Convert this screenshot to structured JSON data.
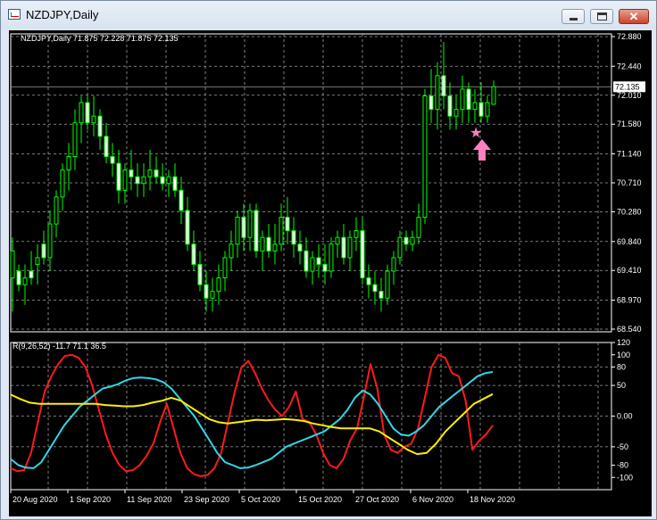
{
  "window": {
    "title": "NZDJPY,Daily",
    "minimize_glyph": "—",
    "maximize_glyph": "☐",
    "close_glyph": "✕"
  },
  "price_panel": {
    "info": "NZDJPY,Daily  71.875 72.228 71.875 72.135",
    "current_price": "72.135",
    "y_ticks": [
      "72.880",
      "72.440",
      "72.010",
      "71.580",
      "71.140",
      "70.710",
      "70.280",
      "69.840",
      "69.410",
      "68.970",
      "68.540"
    ],
    "candle_color": "#00ff00",
    "marker_star_color": "#ff80c0",
    "marker_arrow_color": "#ff80c0"
  },
  "indicator_panel": {
    "info": "R(9,26,52) -11.7 71.1 36.5",
    "y_ticks": [
      "120",
      "100",
      "80",
      "50",
      "0.00",
      "-50",
      "-80",
      "-100"
    ],
    "line_colors": {
      "red": "#ff1a1a",
      "cyan": "#33d6e6",
      "yellow": "#ffee00"
    }
  },
  "x_labels": [
    "20 Aug 2020",
    "1 Sep 2020",
    "11 Sep 2020",
    "23 Sep 2020",
    "5 Oct 2020",
    "15 Oct 2020",
    "27 Oct 2020",
    "6 Nov 2020",
    "18 Nov 2020"
  ],
  "chart_data": [
    {
      "type": "candlestick",
      "title": "NZDJPY,Daily",
      "ylim": [
        68.54,
        72.88
      ],
      "open": 71.875,
      "high": 72.228,
      "low": 71.875,
      "close": 72.135,
      "candles": [
        [
          69.3,
          69.9,
          68.8,
          69.7
        ],
        [
          69.4,
          69.5,
          69.1,
          69.2
        ],
        [
          69.2,
          69.5,
          68.9,
          69.3
        ],
        [
          69.4,
          69.7,
          69.2,
          69.3
        ],
        [
          69.5,
          69.8,
          69.2,
          69.6
        ],
        [
          69.8,
          70.0,
          69.5,
          69.6
        ],
        [
          69.6,
          70.3,
          69.4,
          70.1
        ],
        [
          70.1,
          70.6,
          69.9,
          70.5
        ],
        [
          70.5,
          71.0,
          70.3,
          70.9
        ],
        [
          70.9,
          71.3,
          70.6,
          71.1
        ],
        [
          71.1,
          71.8,
          70.9,
          71.6
        ],
        [
          71.6,
          72.0,
          71.3,
          71.9
        ],
        [
          71.9,
          72.0,
          71.5,
          71.6
        ],
        [
          71.6,
          72.0,
          71.4,
          71.7
        ],
        [
          71.7,
          71.8,
          71.2,
          71.4
        ],
        [
          71.4,
          71.6,
          71.0,
          71.1
        ],
        [
          71.1,
          71.3,
          70.8,
          71.0
        ],
        [
          71.0,
          71.2,
          70.4,
          70.6
        ],
        [
          70.6,
          71.0,
          70.4,
          70.9
        ],
        [
          70.9,
          71.2,
          70.6,
          70.8
        ],
        [
          70.8,
          71.0,
          70.5,
          70.7
        ],
        [
          70.7,
          71.0,
          70.5,
          70.8
        ],
        [
          70.8,
          71.2,
          70.6,
          70.9
        ],
        [
          70.9,
          71.1,
          70.7,
          70.8
        ],
        [
          70.8,
          71.0,
          70.6,
          70.7
        ],
        [
          70.7,
          70.9,
          70.5,
          70.8
        ],
        [
          70.8,
          71.0,
          70.5,
          70.6
        ],
        [
          70.6,
          70.8,
          70.1,
          70.3
        ],
        [
          70.3,
          70.5,
          69.7,
          69.8
        ],
        [
          69.8,
          70.0,
          69.4,
          69.5
        ],
        [
          69.5,
          69.7,
          69.1,
          69.2
        ],
        [
          69.2,
          69.4,
          68.8,
          69.0
        ],
        [
          69.0,
          69.3,
          68.8,
          69.1
        ],
        [
          69.1,
          69.5,
          68.9,
          69.3
        ],
        [
          69.3,
          69.7,
          69.1,
          69.6
        ],
        [
          69.6,
          70.0,
          69.4,
          69.8
        ],
        [
          69.8,
          70.3,
          69.6,
          70.2
        ],
        [
          70.2,
          70.4,
          69.7,
          69.9
        ],
        [
          69.9,
          70.4,
          69.7,
          70.3
        ],
        [
          70.3,
          70.4,
          69.6,
          69.7
        ],
        [
          69.7,
          70.0,
          69.4,
          69.9
        ],
        [
          69.9,
          70.1,
          69.6,
          69.7
        ],
        [
          69.7,
          70.1,
          69.5,
          69.8
        ],
        [
          69.8,
          70.4,
          69.7,
          70.2
        ],
        [
          70.2,
          70.5,
          69.8,
          70.0
        ],
        [
          70.0,
          70.2,
          69.6,
          69.8
        ],
        [
          69.8,
          70.0,
          69.5,
          69.7
        ],
        [
          69.7,
          69.9,
          69.3,
          69.4
        ],
        [
          69.4,
          69.7,
          69.2,
          69.6
        ],
        [
          69.6,
          69.8,
          69.3,
          69.5
        ],
        [
          69.5,
          69.8,
          69.2,
          69.4
        ],
        [
          69.4,
          69.9,
          69.3,
          69.8
        ],
        [
          69.8,
          70.0,
          69.6,
          69.9
        ],
        [
          69.9,
          70.1,
          69.5,
          69.6
        ],
        [
          69.6,
          70.0,
          69.4,
          69.9
        ],
        [
          69.9,
          70.2,
          69.7,
          70.0
        ],
        [
          70.0,
          70.2,
          69.2,
          69.3
        ],
        [
          69.3,
          69.5,
          69.0,
          69.2
        ],
        [
          69.2,
          69.4,
          68.9,
          69.1
        ],
        [
          69.1,
          69.3,
          68.8,
          69.0
        ],
        [
          69.0,
          69.5,
          68.9,
          69.4
        ],
        [
          69.4,
          69.7,
          69.2,
          69.6
        ],
        [
          69.6,
          70.0,
          69.5,
          69.9
        ],
        [
          69.9,
          70.0,
          69.7,
          69.8
        ],
        [
          69.8,
          70.0,
          69.7,
          69.9
        ],
        [
          69.9,
          70.4,
          69.8,
          70.2
        ],
        [
          70.2,
          72.1,
          70.1,
          72.0
        ],
        [
          72.0,
          72.4,
          71.6,
          71.8
        ],
        [
          71.8,
          72.5,
          71.5,
          72.3
        ],
        [
          72.3,
          72.8,
          71.8,
          72.0
        ],
        [
          72.0,
          72.2,
          71.5,
          71.7
        ],
        [
          71.7,
          72.0,
          71.5,
          71.8
        ],
        [
          71.8,
          72.3,
          71.6,
          72.1
        ],
        [
          72.1,
          72.2,
          71.6,
          71.8
        ],
        [
          71.8,
          72.1,
          71.6,
          71.9
        ],
        [
          71.9,
          72.2,
          71.6,
          71.7
        ],
        [
          71.7,
          72.0,
          71.6,
          71.9
        ],
        [
          71.875,
          72.228,
          71.875,
          72.135
        ]
      ],
      "markers": [
        {
          "type": "star",
          "price": 71.45
        },
        {
          "type": "up-arrow",
          "price": 71.2
        }
      ]
    },
    {
      "type": "line",
      "title": "R(9,26,52)",
      "ylim": [
        -120,
        120
      ],
      "series": [
        {
          "name": "R(9)",
          "values": [
            -85,
            -90,
            -88,
            -60,
            -10,
            40,
            65,
            85,
            98,
            100,
            95,
            80,
            50,
            10,
            -30,
            -60,
            -80,
            -90,
            -88,
            -80,
            -65,
            -45,
            -10,
            20,
            -20,
            -60,
            -85,
            -95,
            -98,
            -96,
            -85,
            -60,
            -10,
            40,
            80,
            90,
            70,
            45,
            25,
            10,
            0,
            15,
            40,
            -5,
            -10,
            -30,
            -60,
            -80,
            -85,
            -70,
            -40,
            -20,
            30,
            85,
            45,
            -30,
            -55,
            -60,
            -50,
            -45,
            -20,
            30,
            80,
            100,
            95,
            70,
            65,
            25,
            -55,
            -40,
            -30,
            -15
          ]
        },
        {
          "name": "R(26)",
          "values": [
            -70,
            -80,
            -84,
            -85,
            -75,
            -55,
            -35,
            -15,
            0,
            15,
            25,
            35,
            45,
            48,
            52,
            58,
            62,
            63,
            62,
            60,
            55,
            45,
            30,
            15,
            0,
            -20,
            -40,
            -60,
            -75,
            -80,
            -85,
            -84,
            -80,
            -75,
            -70,
            -60,
            -50,
            -45,
            -40,
            -35,
            -30,
            -25,
            -15,
            -5,
            10,
            30,
            42,
            35,
            20,
            0,
            -20,
            -30,
            -32,
            -25,
            -15,
            0,
            15,
            25,
            35,
            45,
            55,
            65,
            70,
            72
          ]
        },
        {
          "name": "R(52)",
          "values": [
            35,
            28,
            22,
            20,
            20,
            20,
            20,
            20,
            20,
            20,
            18,
            17,
            16,
            16,
            18,
            22,
            25,
            30,
            25,
            15,
            5,
            -5,
            -10,
            -12,
            -10,
            -8,
            -6,
            -7,
            -6,
            -5,
            -6,
            -8,
            -12,
            -15,
            -18,
            -20,
            -20,
            -20,
            -20,
            -25,
            -35,
            -45,
            -55,
            -62,
            -60,
            -45,
            -25,
            -10,
            5,
            20,
            28,
            36
          ]
        }
      ]
    }
  ]
}
